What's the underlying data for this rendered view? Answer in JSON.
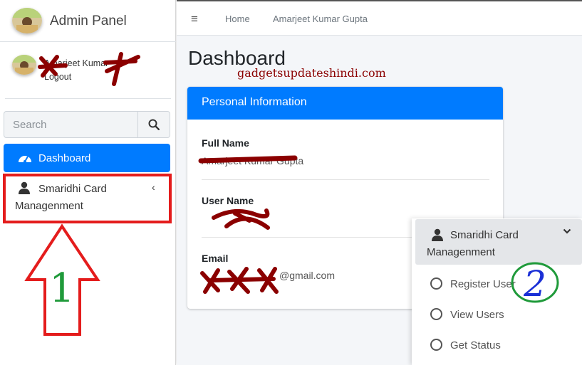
{
  "brand": {
    "title": "Admin Panel"
  },
  "user_panel": {
    "name": "Amarjeet Kumar",
    "logout": "Logout"
  },
  "search": {
    "placeholder": "Search"
  },
  "sidebar": {
    "dashboard": "Dashboard",
    "smaridhi_line1": "Smaridhi Card",
    "smaridhi_line2": "Managenment"
  },
  "topbar": {
    "menu_icon": "≡",
    "home": "Home",
    "user": "Amarjeet Kumar Gupta"
  },
  "main": {
    "title": "Dashboard",
    "watermark": "gadgetsupdateshindi.com",
    "card": {
      "header": "Personal Information",
      "full_name_label": "Full Name",
      "full_name_value": "Amarjeet Kumar Gupta",
      "user_name_label": "User Name",
      "user_name_value": "",
      "email_label": "Email",
      "email_value": "@gmail.com"
    }
  },
  "dropdown": {
    "line1": "Smaridhi Card",
    "line2": "Managenment",
    "items": [
      "Register User",
      "View Users",
      "Get Status"
    ]
  },
  "annotations": {
    "step1": "1",
    "step2": "2"
  },
  "colors": {
    "primary": "#007bff",
    "highlight": "#e41c1c",
    "redaction": "#8b0000",
    "step1_color": "#1f9a3a",
    "step2_color": "#1a2fd6"
  }
}
